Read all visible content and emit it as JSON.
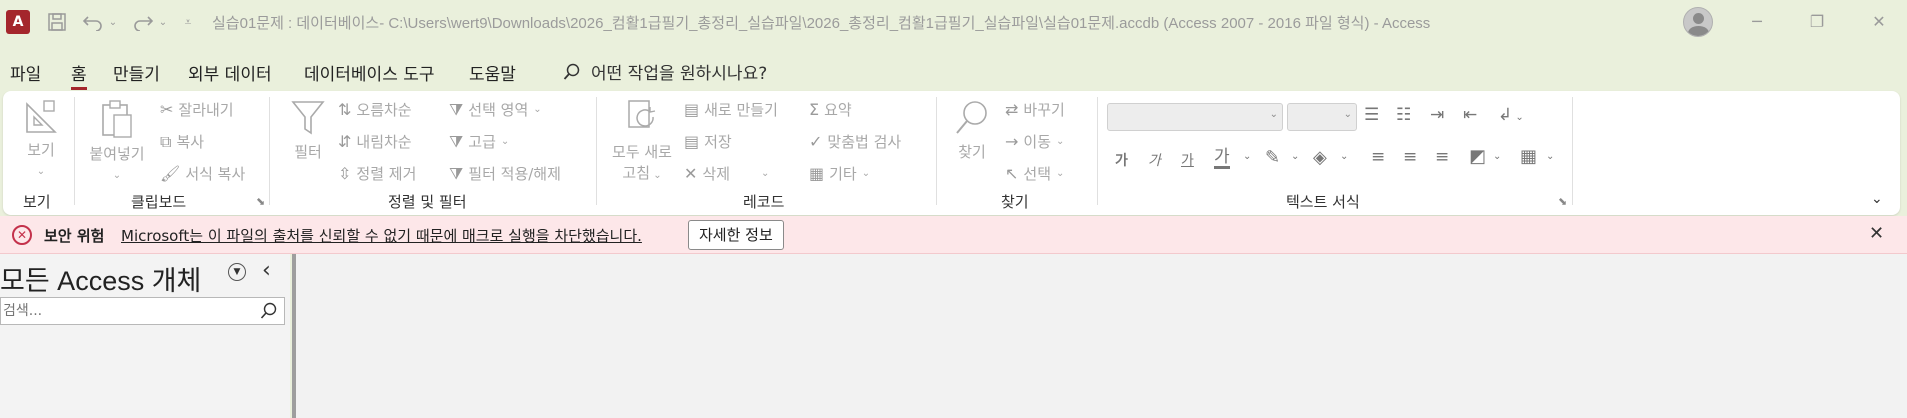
{
  "app": {
    "logo_letter": "A",
    "accent_color": "#a4262c",
    "window_title": "실습01문제 : 데이터베이스- C:\\Users\\wert9\\Downloads\\2026_컴활1급필기_총정리_실습파일\\2026_총정리_컴활1급필기_실습파일\\실습01문제.accdb (Access 2007 - 2016 파일 형식)  -  Access"
  },
  "qat": {
    "save_icon": "save-icon",
    "undo_icon": "undo-icon",
    "redo_icon": "redo-icon",
    "customize_icon": "customize-qat-icon"
  },
  "menu": {
    "tabs": [
      {
        "label": "파일"
      },
      {
        "label": "홈"
      },
      {
        "label": "만들기"
      },
      {
        "label": "외부 데이터"
      },
      {
        "label": "데이터베이스 도구"
      },
      {
        "label": "도움말"
      }
    ],
    "tellme": "어떤 작업을 원하시나요?"
  },
  "ribbon": {
    "groups": {
      "views": "보기",
      "clipboard": "클립보드",
      "sort_filter": "정렬 및 필터",
      "records": "레코드",
      "find": "찾기",
      "text_format": "텍스트 서식"
    },
    "buttons": {
      "view": "보기",
      "paste": "붙여넣기",
      "cut": "잘라내기",
      "copy": "복사",
      "format_painter": "서식 복사",
      "filter": "필터",
      "ascending": "오름차순",
      "descending": "내림차순",
      "remove_sort": "정렬 제거",
      "selection": "선택 영역",
      "advanced": "고급",
      "toggle_filter": "필터 적용/해제",
      "refresh_all_1": "모두 새로",
      "refresh_all_2": "고침",
      "new": "새로 만들기",
      "save": "저장",
      "delete": "삭제",
      "totals": "요약",
      "spelling": "맞춤법 검사",
      "more": "기타",
      "find": "찾기",
      "replace": "바꾸기",
      "goto": "이동",
      "select": "선택"
    },
    "format_glyphs": {
      "bold": "가",
      "italic": "가",
      "underline": "가",
      "font_color": "가"
    }
  },
  "message_bar": {
    "title": "보안 위험",
    "text": "Microsoft는 이 파일의 출처를 신뢰할 수 없기 때문에 매크로 실행을 차단했습니다.",
    "button": "자세한 정보",
    "bg_color": "#fde7e9"
  },
  "nav_pane": {
    "title": "모든 Access 개체",
    "search_placeholder": "검색..."
  }
}
